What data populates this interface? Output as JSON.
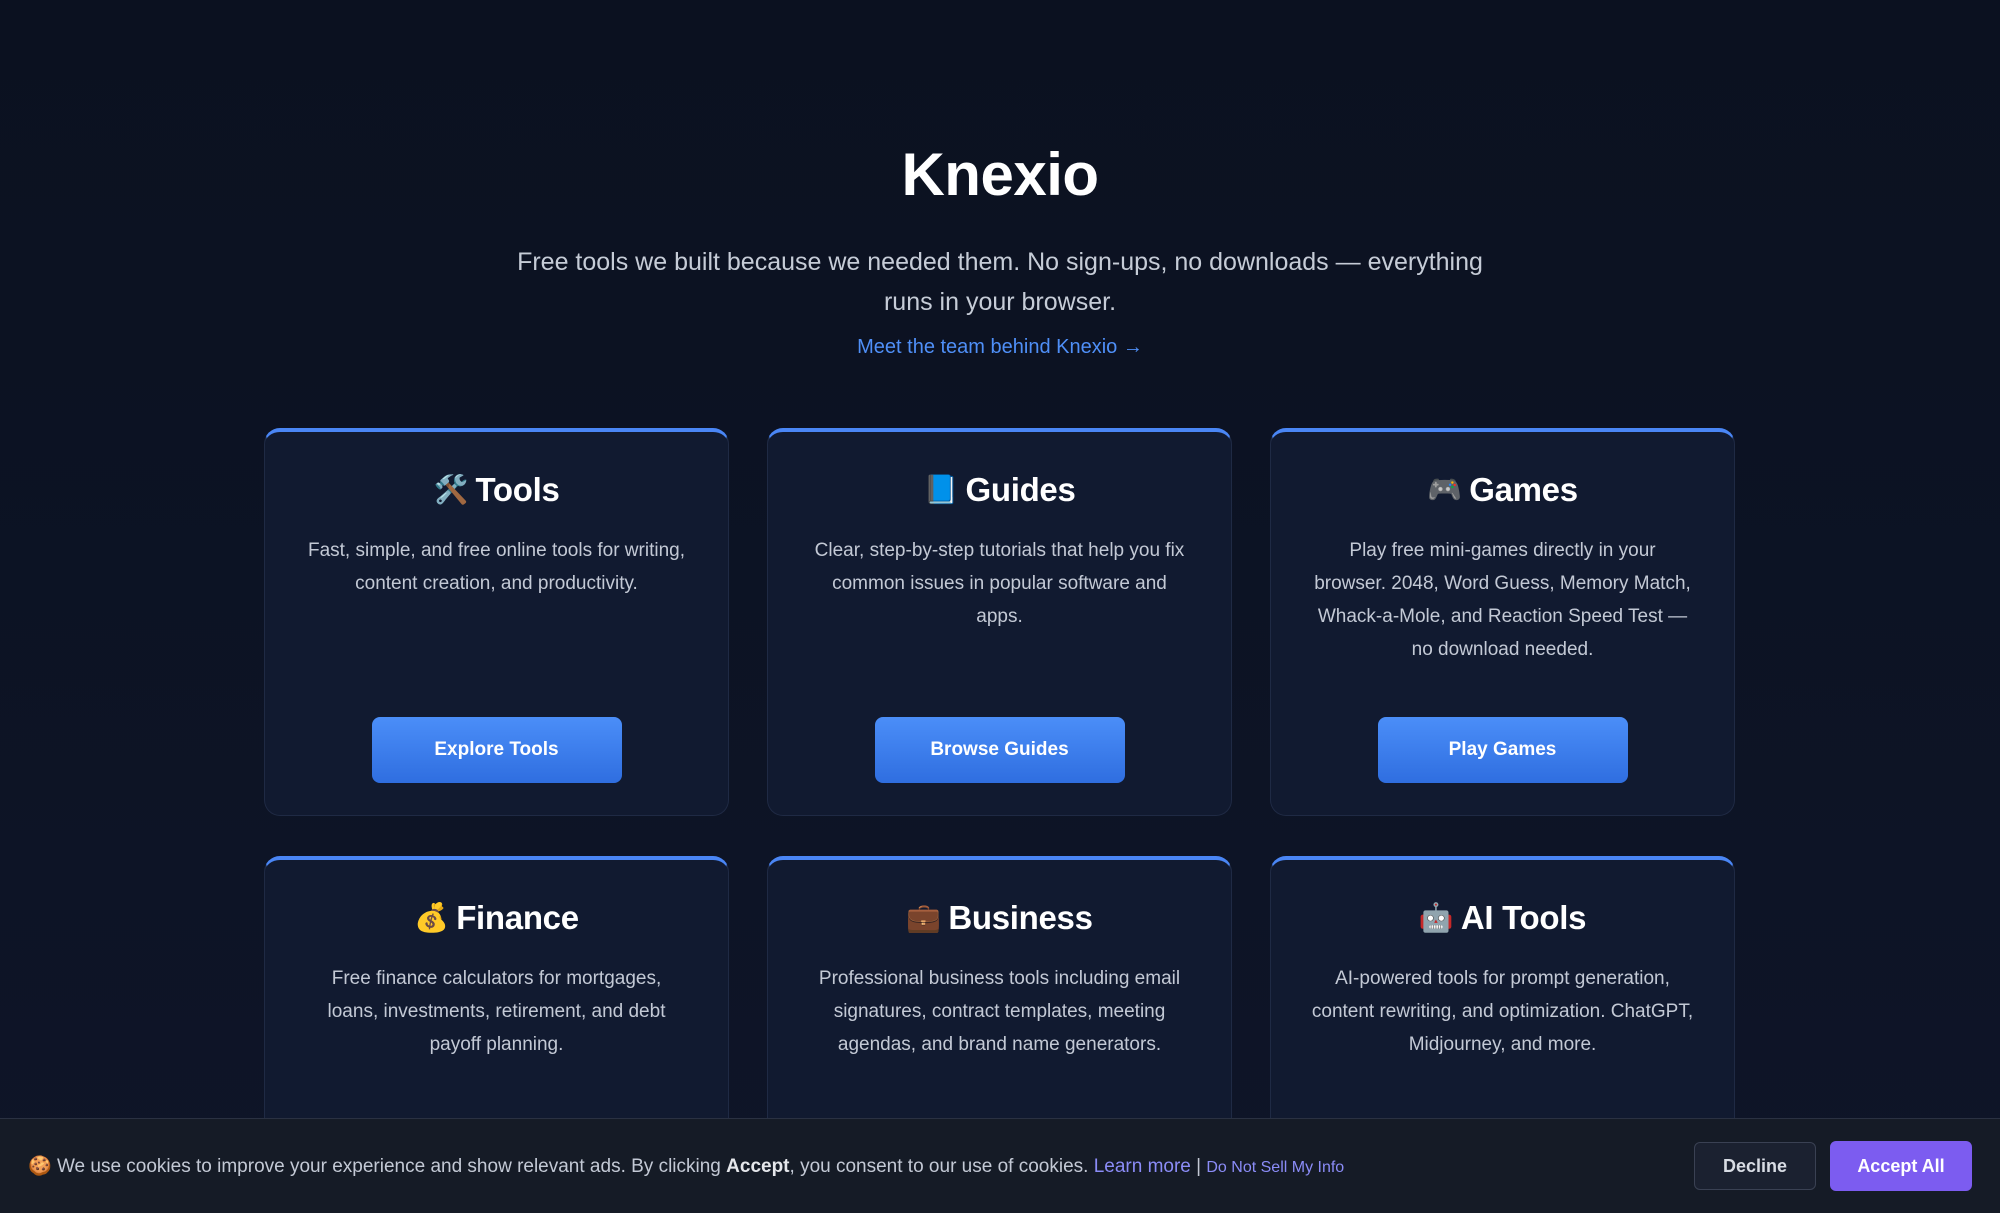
{
  "hero": {
    "title": "Knexio",
    "tagline": "Free tools we built because we needed them. No sign-ups, no downloads — everything runs in your browser.",
    "team_link": "Meet the team behind Knexio →"
  },
  "cards": [
    {
      "icon": "🛠️",
      "icon_name": "hammer-wrench-icon",
      "title": "Tools",
      "desc": "Fast, simple, and free online tools for writing, content creation, and productivity.",
      "button": "Explore Tools"
    },
    {
      "icon": "📘",
      "icon_name": "blue-book-icon",
      "title": "Guides",
      "desc": "Clear, step-by-step tutorials that help you fix common issues in popular software and apps.",
      "button": "Browse Guides"
    },
    {
      "icon": "🎮",
      "icon_name": "game-controller-icon",
      "title": "Games",
      "desc": "Play free mini-games directly in your browser. 2048, Word Guess, Memory Match, Whack-a-Mole, and Reaction Speed Test — no download needed.",
      "button": "Play Games"
    },
    {
      "icon": "💰",
      "icon_name": "money-bag-icon",
      "title": "Finance",
      "desc": "Free finance calculators for mortgages, loans, investments, retirement, and debt payoff planning."
    },
    {
      "icon": "💼",
      "icon_name": "briefcase-icon",
      "title": "Business",
      "desc": "Professional business tools including email signatures, contract templates, meeting agendas, and brand name generators."
    },
    {
      "icon": "🤖",
      "icon_name": "robot-icon",
      "title": "AI Tools",
      "desc": "AI-powered tools for prompt generation, content rewriting, and optimization. ChatGPT, Midjourney, and more."
    }
  ],
  "cookie": {
    "icon": "🍪",
    "text_before": "We use cookies to improve your experience and show relevant ads. By clicking ",
    "bold": "Accept",
    "text_after": ", you consent to our use of cookies. ",
    "learn_more": "Learn more",
    "separator": " | ",
    "do_not_sell": "Do Not Sell My Info",
    "decline": "Decline",
    "accept_all": "Accept All"
  },
  "colors": {
    "background": "#0b1120",
    "card": "#111a30",
    "accent": "#4a86f5",
    "link": "#4f8ff7",
    "accept": "#7c5cf0"
  }
}
